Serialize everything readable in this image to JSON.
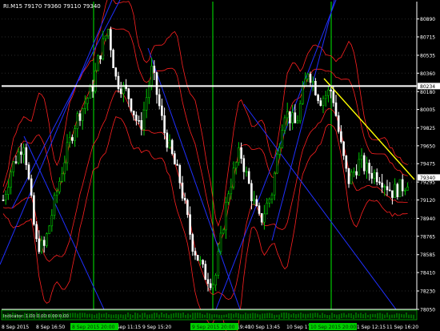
{
  "header": {
    "symbol_tf": "RI.M15",
    "ohlc": "79170 79360 79110 79340"
  },
  "chart_data": {
    "type": "candlestick",
    "ylim": [
      78050,
      81060
    ],
    "price_levels": [
      80890,
      80715,
      80535,
      80360,
      80180,
      80005,
      79825,
      79650,
      79475,
      79295,
      79120,
      78940,
      78765,
      78585,
      78410,
      78230,
      78050
    ],
    "current_price": "79340",
    "horizontal_line_price": "80234",
    "time_labels": [
      "8 Sep 2015",
      "8 Sep 16:50",
      "9 Sep 11:15",
      "9 Sep 15:20",
      "9 Sep 19:40",
      "10 Sep 13:45",
      "10 Sep 17:55",
      "11 Sep 12:15",
      "11 Sep 16:20"
    ],
    "highlighted_time_labels": [
      "8 Sep 2015 20:00",
      "9 Sep 2015 20:00",
      "10 Sep 2015 20:00"
    ],
    "indicator_label": "Indicator: 1.00 0.00 0.00 0.00",
    "colors": {
      "background": "#000000",
      "axis_text": "#ffffff",
      "envelope": "#ff2020",
      "trendline": "#2030ff",
      "projection": "#ffff00",
      "level": "#ffffff",
      "separator": "#00ee00",
      "up": "#00cc00",
      "down": "#ffffff"
    }
  }
}
